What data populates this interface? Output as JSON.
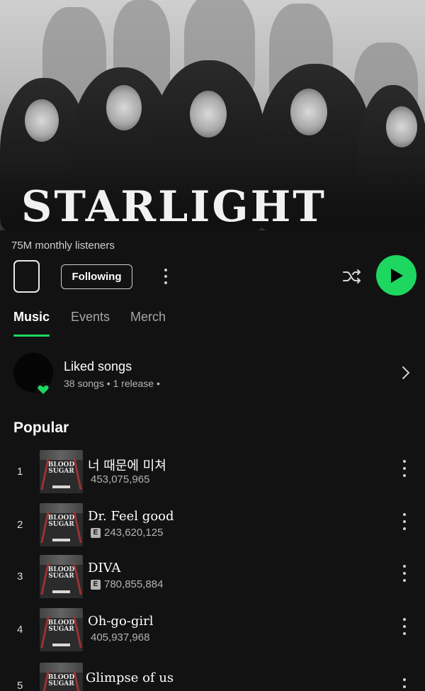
{
  "artist": {
    "name": "STARLIGHT",
    "monthly_listeners": "75M monthly listeners"
  },
  "controls": {
    "follow_label": "Following",
    "more_icon": "more-vertical-icon",
    "shuffle_icon": "shuffle-icon",
    "play_icon": "play-icon"
  },
  "tabs": [
    {
      "label": "Music",
      "active": true
    },
    {
      "label": "Events",
      "active": false
    },
    {
      "label": "Merch",
      "active": false
    }
  ],
  "liked": {
    "title": "Liked songs",
    "subtitle": "38 songs • 1 release •"
  },
  "popular": {
    "title": "Popular",
    "tracks": [
      {
        "rank": "1",
        "title": "너 때문에 미쳐",
        "plays": "453,075,965",
        "explicit": false
      },
      {
        "rank": "2",
        "title": "Dr. Feel good",
        "plays": "243,620,125",
        "explicit": true
      },
      {
        "rank": "3",
        "title": "DIVA",
        "plays": "780,855,884",
        "explicit": true
      },
      {
        "rank": "4",
        "title": "Oh-go-girl",
        "plays": "405,937,968",
        "explicit": false
      },
      {
        "rank": "5",
        "title": "Glimpse of us",
        "plays": "",
        "explicit": false
      }
    ]
  },
  "cover_art": {
    "text_line1": "BLOOD",
    "text_line2": "SUGAR"
  },
  "colors": {
    "accent": "#1ed760",
    "background": "#121212"
  }
}
